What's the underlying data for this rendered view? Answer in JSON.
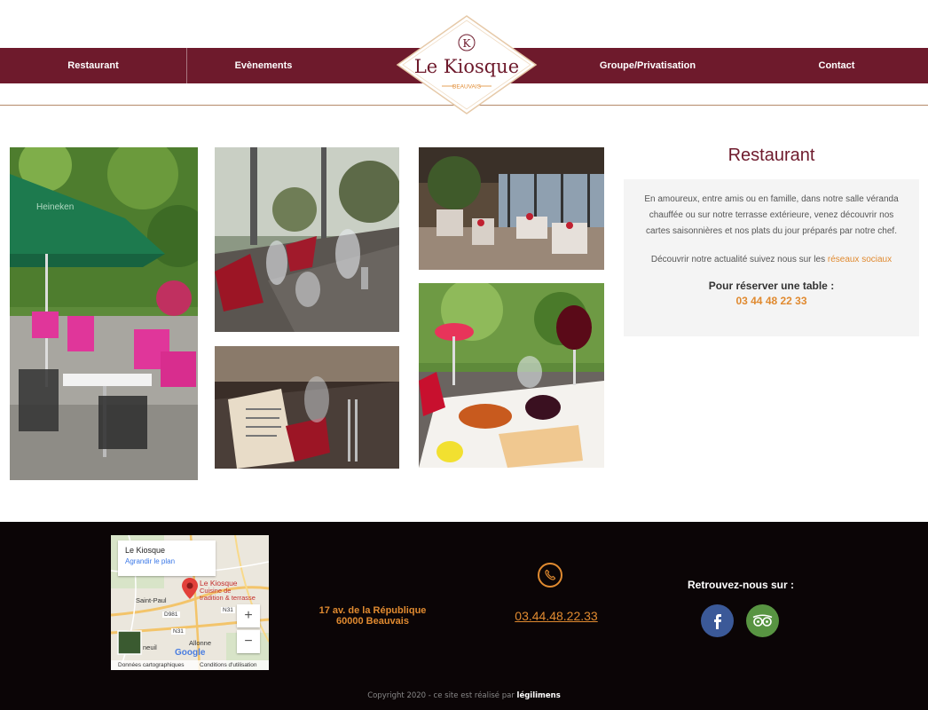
{
  "nav": {
    "items": [
      {
        "label": "Restaurant"
      },
      {
        "label": "Evènements"
      },
      {
        "label": "Groupe/Privatisation"
      },
      {
        "label": "Contact"
      }
    ],
    "bar_color": "#6e1a2c"
  },
  "logo": {
    "name": "Le Kiosque",
    "initial": "K",
    "city": "BEAUVAIS"
  },
  "info": {
    "title": "Restaurant",
    "description": "En amoureux, entre amis ou en famille, dans notre salle véranda chauffée ou sur notre terrasse extérieure, venez découvrir nos cartes saisonnières et nos plats du jour préparés par notre chef.",
    "social_prefix": "Découvrir notre actualité suivez nous sur les",
    "social_link": "réseaux sociaux",
    "reserve_label": "Pour réserver une table :",
    "reserve_phone": "03 44 48 22 33"
  },
  "footer": {
    "map": {
      "place_name": "Le Kiosque",
      "enlarge_link": "Agrandir le plan",
      "marker_label_1": "Le Kiosque",
      "marker_label_2": "Cuisine de",
      "marker_label_3": "tradition & terrasse",
      "town_1": "Saint-Paul",
      "town_2": "Allonne",
      "town_3": "neuil",
      "road_1": "D981",
      "road_2": "N31",
      "road_3": "N31",
      "zoom_in": "+",
      "zoom_out": "−",
      "map_data": "Données cartographiques",
      "terms": "Conditions d'utilisation",
      "brand": "Google"
    },
    "address_line1": "17 av. de la République",
    "address_line2": "60000 Beauvais",
    "phone": "03.44.48.22.33",
    "social_title": "Retrouvez-nous sur :",
    "copyright_prefix": "Copyright 2020 - ce site est réalisé par",
    "copyright_brand": "légilimens"
  },
  "colors": {
    "accent": "#e08a30",
    "burgundy": "#6e1a2c",
    "facebook": "#3b5998",
    "tripadvisor": "#589442"
  },
  "icons": [
    "phone-icon",
    "facebook-icon",
    "tripadvisor-icon",
    "map-pin-icon"
  ]
}
